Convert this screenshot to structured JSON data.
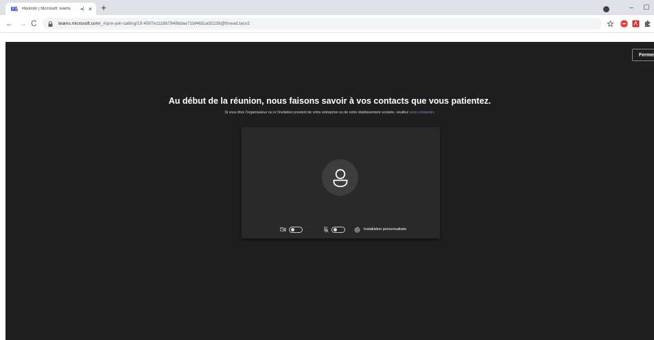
{
  "browser": {
    "tab_title": "Réunion | Microsoft Teams",
    "new_tab_symbol": "+",
    "url_host": "teams.microsoft.com",
    "url_path": "/_#/pre-join-calling/19:4597e1118b7948bdae71bf465ca55238@thread.tacv2",
    "window_controls": {
      "minimize": "–",
      "maximize": "☐"
    },
    "icons": [
      "teams-favicon",
      "speaker-icon",
      "close-icon",
      "back-icon",
      "forward-icon",
      "reload-icon",
      "lock-icon",
      "star-icon",
      "adblock-extension-icon",
      "pdf-extension-icon",
      "extensions-puzzle-icon",
      "profile-icon"
    ]
  },
  "prejoin": {
    "close_label": "Fermer",
    "headline": "Au début de la réunion, nous faisons savoir à vos contacts que vous patientez.",
    "subline_prefix": "Si vous êtes l'organisateur ou si l'invitation provient de votre entreprise ou de votre établissement scolaire, veuillez ",
    "subline_link": "vous connecter",
    "subline_suffix": ".",
    "camera_on": false,
    "mic_on": false,
    "settings_label": "Installation personnalisée"
  },
  "colors": {
    "background": "#1f1f1f",
    "preview": "#292929",
    "link": "#8b8cc7",
    "teams_purple": "#5059c9"
  }
}
